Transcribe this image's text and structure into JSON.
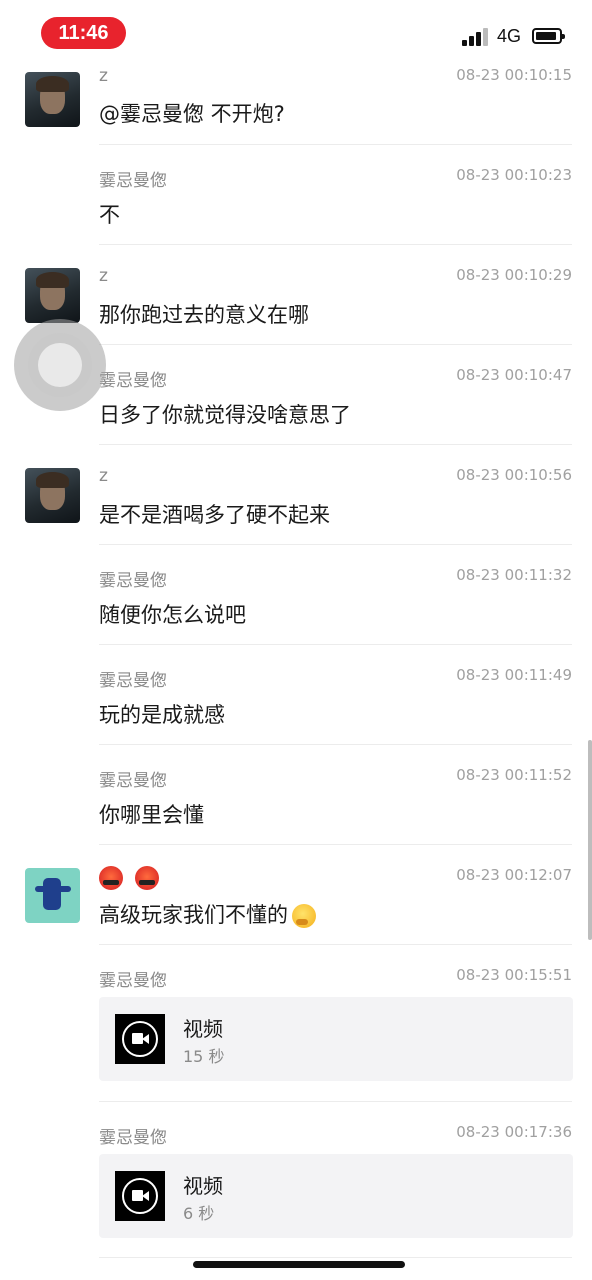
{
  "status_bar": {
    "time": "11:46",
    "network": "4G"
  },
  "messages": [
    {
      "sender": "z",
      "time": "08-23 00:10:15",
      "text": "@霎忌曼偬 不开炮?"
    },
    {
      "sender": "霎忌曼偬",
      "time": "08-23 00:10:23",
      "text": "不"
    },
    {
      "sender": "z",
      "time": "08-23 00:10:29",
      "text": "那你跑过去的意义在哪"
    },
    {
      "sender": "霎忌曼偬",
      "time": "08-23 00:10:47",
      "text": "日多了你就觉得没啥意思了"
    },
    {
      "sender": "z",
      "time": "08-23 00:10:56",
      "text": "是不是酒喝多了硬不起来"
    },
    {
      "sender": "霎忌曼偬",
      "time": "08-23 00:11:32",
      "text": "随便你怎么说吧"
    },
    {
      "sender": "霎忌曼偬",
      "time": "08-23 00:11:49",
      "text": "玩的是成就感"
    },
    {
      "sender": "霎忌曼偬",
      "time": "08-23 00:11:52",
      "text": "你哪里会懂"
    },
    {
      "sender_icons": [
        "angry-face-emoji",
        "angry-face-emoji"
      ],
      "time": "08-23 00:12:07",
      "text": "高级玩家我们不懂的",
      "text_icon": "thinking-face-emoji"
    },
    {
      "sender": "霎忌曼偬",
      "time": "08-23 00:15:51",
      "video": {
        "title": "视频",
        "duration": "15 秒"
      }
    },
    {
      "sender": "霎忌曼偬",
      "time": "08-23 00:17:36",
      "video": {
        "title": "视频",
        "duration": "6 秒"
      }
    }
  ],
  "colors": {
    "time_pill": "#e8232d",
    "timestamp": "#a0a0a0",
    "sender": "#8a8a8a",
    "card_bg": "#f3f3f5"
  }
}
